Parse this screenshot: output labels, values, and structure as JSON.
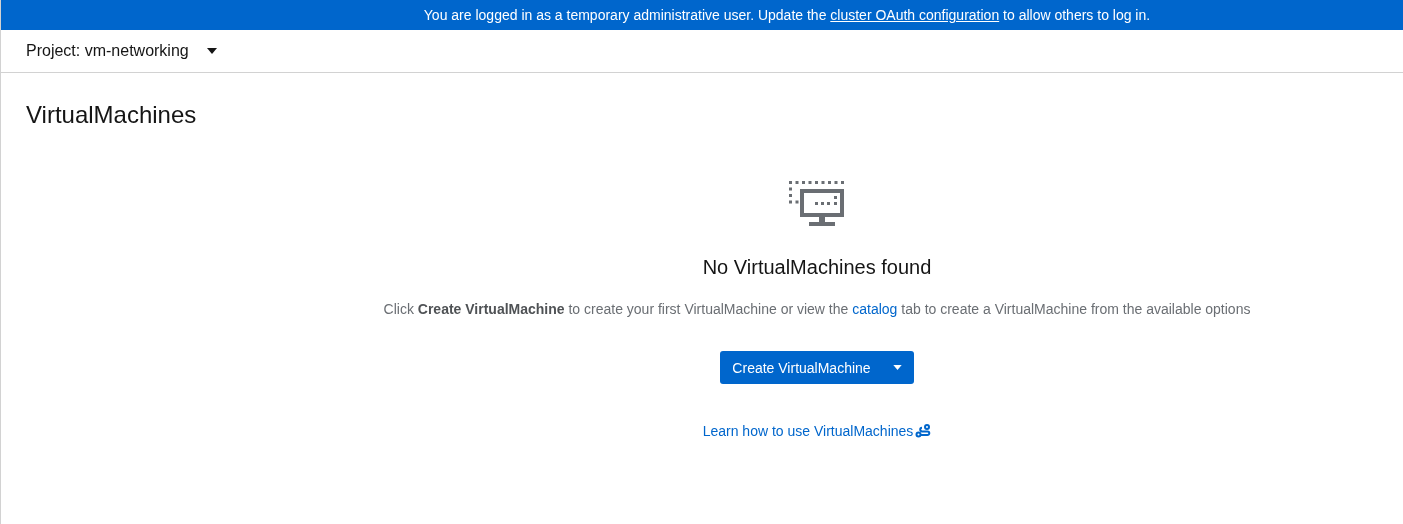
{
  "banner": {
    "before": "You are logged in as a temporary administrative user. Update the",
    "link": "cluster OAuth configuration",
    "after": "to allow others to log in."
  },
  "project_selector": {
    "label": "Project: vm-networking"
  },
  "page_title": "VirtualMachines",
  "empty_state": {
    "heading": "No VirtualMachines found",
    "description": {
      "before": "Click **Create VirtualMachine** to create your first VirtualMachine or view the",
      "link": "catalog",
      "after": "tab to create a VirtualMachine from the available options"
    },
    "create_button": "Create VirtualMachine",
    "learn_link": "Learn how to use VirtualMachines"
  }
}
